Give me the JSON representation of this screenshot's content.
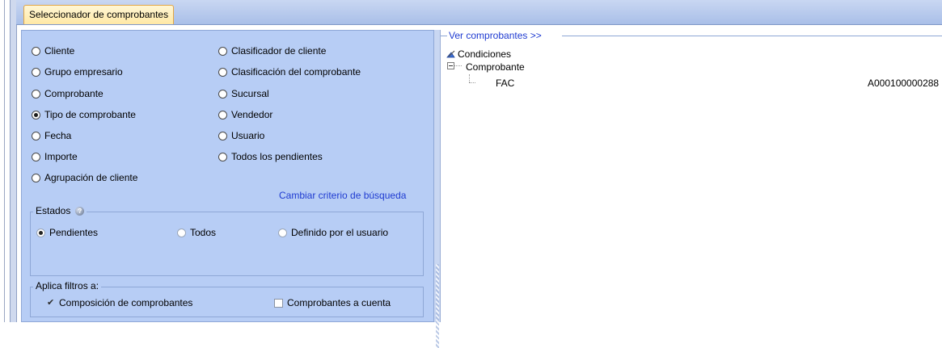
{
  "tab": {
    "label": "Seleccionador de comprobantes"
  },
  "criteria_left": [
    {
      "label": "Cliente",
      "checked": false
    },
    {
      "label": "Grupo empresario",
      "checked": false
    },
    {
      "label": "Comprobante",
      "checked": false
    },
    {
      "label": "Tipo de comprobante",
      "checked": true
    },
    {
      "label": "Fecha",
      "checked": false
    },
    {
      "label": "Importe",
      "checked": false
    },
    {
      "label": "Agrupación de cliente",
      "checked": false
    }
  ],
  "criteria_right": [
    {
      "label": "Clasificador de cliente",
      "checked": false
    },
    {
      "label": "Clasificación del comprobante",
      "checked": false
    },
    {
      "label": "Sucursal",
      "checked": false
    },
    {
      "label": "Vendedor",
      "checked": false
    },
    {
      "label": "Usuario",
      "checked": false
    },
    {
      "label": "Todos los pendientes",
      "checked": false
    }
  ],
  "change_criteria_link": "Cambiar criterio de búsqueda",
  "estados": {
    "legend": "Estados",
    "options": [
      {
        "label": "Pendientes",
        "checked": true
      },
      {
        "label": "Todos",
        "checked": false
      },
      {
        "label": "Definido por el usuario",
        "checked": false
      }
    ]
  },
  "filtros": {
    "legend": "Aplica filtros a:",
    "options": [
      {
        "label": "Composición de comprobantes",
        "checked": true
      },
      {
        "label": "Comprobantes a cuenta",
        "checked": false
      }
    ]
  },
  "results": {
    "header_link": "Ver comprobantes >>",
    "tree": {
      "root": "Condiciones",
      "child": "Comprobante",
      "leaf": "FAC",
      "leaf_value": "A000100000288"
    }
  }
}
